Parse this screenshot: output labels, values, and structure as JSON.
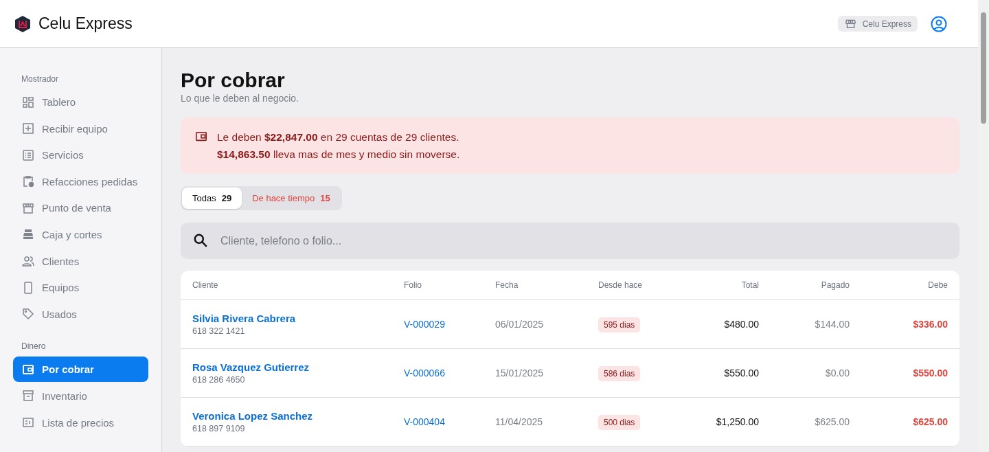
{
  "brand": {
    "name": "Celu Express"
  },
  "header": {
    "store_chip": "Celu Express"
  },
  "sidebar": {
    "sections": [
      {
        "title": "Mostrador",
        "items": [
          {
            "label": "Tablero",
            "selected": false
          },
          {
            "label": "Recibir equipo",
            "selected": false
          },
          {
            "label": "Servicios",
            "selected": false
          },
          {
            "label": "Refacciones pedidas",
            "selected": false
          },
          {
            "label": "Punto de venta",
            "selected": false
          },
          {
            "label": "Caja y cortes",
            "selected": false
          },
          {
            "label": "Clientes",
            "selected": false
          },
          {
            "label": "Equipos",
            "selected": false
          },
          {
            "label": "Usados",
            "selected": false
          }
        ]
      },
      {
        "title": "Dinero",
        "items": [
          {
            "label": "Por cobrar",
            "selected": true
          },
          {
            "label": "Inventario",
            "selected": false
          },
          {
            "label": "Lista de precios",
            "selected": false
          }
        ]
      }
    ]
  },
  "page": {
    "title": "Por cobrar",
    "subtitle": "Lo que le deben al negocio."
  },
  "alert": {
    "lines": [
      "Le deben **$22,847.00** en 29 cuentas de 29 clientes.",
      "**$14,863.50** lleva mas de mes y medio sin moverse."
    ]
  },
  "tabs": [
    {
      "label": "Todas",
      "count": "29",
      "selected": true,
      "kind": "normal"
    },
    {
      "label": "De hace tiempo",
      "count": "15",
      "selected": false,
      "kind": "overdue"
    }
  ],
  "search": {
    "placeholder": "Cliente, telefono o folio..."
  },
  "table": {
    "columns": [
      "Cliente",
      "Folio",
      "Fecha",
      "Desde hace",
      "Total",
      "Pagado",
      "Debe"
    ],
    "rows": [
      {
        "name": "Silvia Rivera Cabrera",
        "phone": "618 322 1421",
        "folio": "V-000029",
        "date": "06/01/2025",
        "age": "595 dias",
        "total": "$480.00",
        "paid": "$144.00",
        "owed": "$336.00"
      },
      {
        "name": "Rosa Vazquez Gutierrez",
        "phone": "618 286 4650",
        "folio": "V-000066",
        "date": "15/01/2025",
        "age": "586 dias",
        "total": "$550.00",
        "paid": "$0.00",
        "owed": "$550.00"
      },
      {
        "name": "Veronica Lopez Sanchez",
        "phone": "618 897 9109",
        "folio": "V-000404",
        "date": "11/04/2025",
        "age": "500 dias",
        "total": "$1,250.00",
        "paid": "$625.00",
        "owed": "$625.00"
      }
    ]
  }
}
